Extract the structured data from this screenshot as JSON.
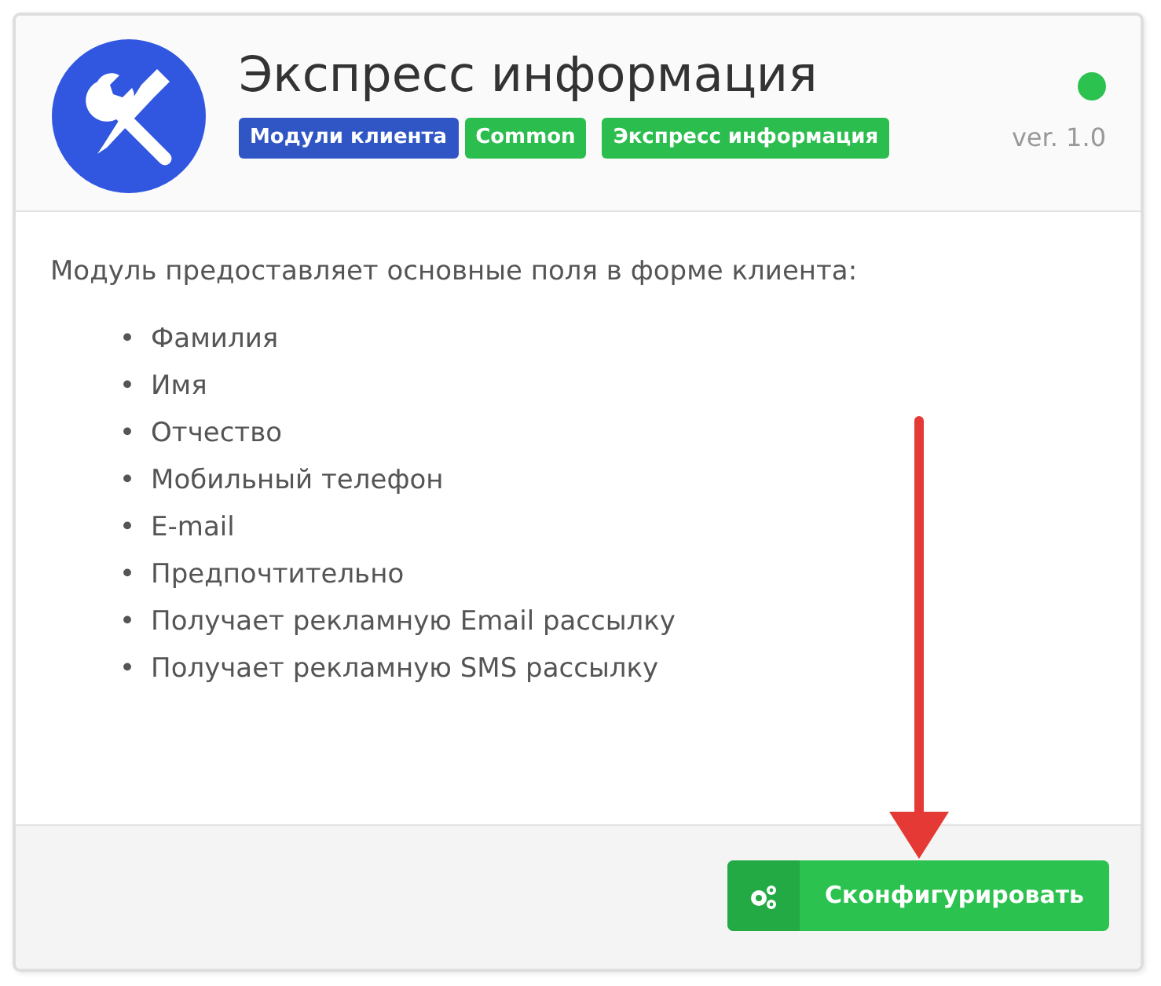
{
  "module": {
    "title": "Экспресс информация",
    "active": true,
    "version": "ver. 1.0",
    "tags": [
      {
        "label": "Модули клиента",
        "color": "#2f56c4"
      },
      {
        "label": "Common",
        "color": "#2bbd4e"
      },
      {
        "label": "Экспресс информация",
        "color": "#2bbd4e"
      }
    ],
    "description": "Модуль предоставляет основные поля в форме клиента:",
    "fields": [
      {
        "bullet": "•",
        "text": "Фамилия"
      },
      {
        "bullet": "•",
        "text": "Имя"
      },
      {
        "bullet": "•",
        "text": "Отчество"
      },
      {
        "bullet": "•",
        "text": "Мобильный телефон"
      },
      {
        "bullet": "•",
        "text": "E-mail"
      },
      {
        "bullet": "•",
        "text": "Предпочтительно"
      },
      {
        "bullet": "•",
        "text": "Получает рекламную Email рассылку"
      },
      {
        "bullet": "•",
        "text": "Получает рекламную SMS рассылку"
      }
    ],
    "button": "Сконфигурировать"
  }
}
